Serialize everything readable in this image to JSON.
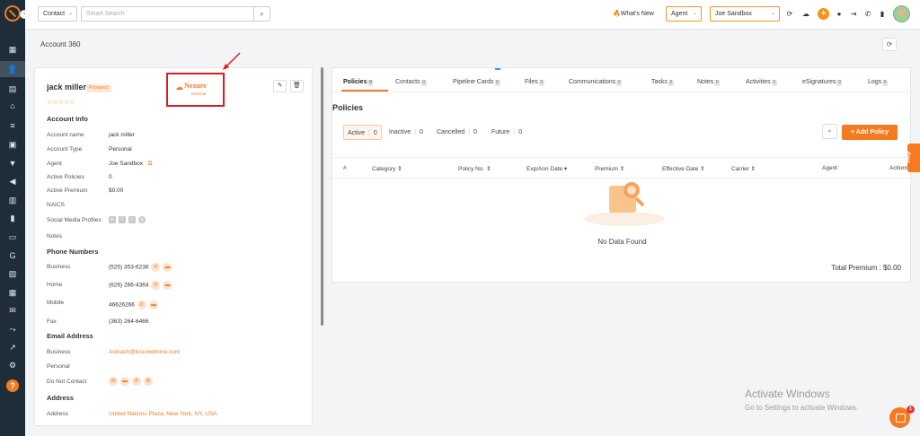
{
  "topbar": {
    "scope_select": "Contact",
    "search_placeholder": "Smart Search",
    "whats_new": "What's New",
    "role_select": "Agent",
    "user_select": "Joe Sandbox"
  },
  "header": {
    "title": "Account 360"
  },
  "account": {
    "name": "jack miller",
    "status_badge": "Prospect",
    "rating_stars": "☆☆☆☆☆",
    "logo_text": "Nexure",
    "logo_subtext": "Re/local",
    "section_account_info": "Account Info",
    "fields": [
      {
        "label": "Account name",
        "value": "jack miller"
      },
      {
        "label": "Account Type",
        "value": "Personal"
      },
      {
        "label": "Agent",
        "value": "Joe Sandbox"
      },
      {
        "label": "Active Policies",
        "value": "0"
      },
      {
        "label": "Active Premium",
        "value": "$0.00"
      },
      {
        "label": "NAICS",
        "value": ""
      },
      {
        "label": "Social Media Profiles",
        "value": ""
      },
      {
        "label": "Notes",
        "value": ""
      }
    ],
    "section_phone": "Phone Numbers",
    "phones": [
      {
        "label": "Business",
        "value": "(525) 353-6236"
      },
      {
        "label": "Home",
        "value": "(626) 266-4364"
      },
      {
        "label": "Mobile",
        "value": "46626266"
      },
      {
        "label": "Fax",
        "value": "(363) 264-6466"
      }
    ],
    "section_email": "Email Address",
    "emails": [
      {
        "label": "Business",
        "value": "Avinash@insuredmine.com"
      },
      {
        "label": "Personal",
        "value": ""
      }
    ],
    "do_not_contact_label": "Do Not Contact",
    "section_address": "Address",
    "address_label": "Address",
    "address_value": "United Nations Plaza, New York, NY, USA"
  },
  "tabs": [
    {
      "label": "Policies",
      "count": "0"
    },
    {
      "label": "Contacts",
      "count": "0"
    },
    {
      "label": "Pipeline Cards",
      "count": "0"
    },
    {
      "label": "Files",
      "count": "0"
    },
    {
      "label": "Communications",
      "count": "0"
    },
    {
      "label": "Tasks",
      "count": "0"
    },
    {
      "label": "Notes",
      "count": "0"
    },
    {
      "label": "Activities",
      "count": "0"
    },
    {
      "label": "eSignatures",
      "count": "0"
    },
    {
      "label": "Logs",
      "count": "0"
    }
  ],
  "policies": {
    "title": "Policies",
    "filters": [
      {
        "label": "Active",
        "count": "0"
      },
      {
        "label": "Inactive",
        "count": "0"
      },
      {
        "label": "Cancelled",
        "count": "0"
      },
      {
        "label": "Future",
        "count": "0"
      }
    ],
    "add_button": "+ Add Policy",
    "columns": [
      "#",
      "Category ⇕",
      "Policy No. ⇕",
      "Exp/Ann Date ▾",
      "Premium ⇕",
      "Effective Date ⇕",
      "Carrier ⇕",
      "Agent",
      "Actions"
    ],
    "empty_text": "No Data Found",
    "total_premium": "Total Premium : $0.00"
  },
  "help_label": "Help",
  "watermark": {
    "line1": "Activate Windows",
    "line2": "Go to Settings to activate Windows."
  },
  "chat_badge": "1",
  "colors": {
    "accent": "#f47b20",
    "nav_bg": "#1f2d3a",
    "annotation": "#e01b1b"
  }
}
